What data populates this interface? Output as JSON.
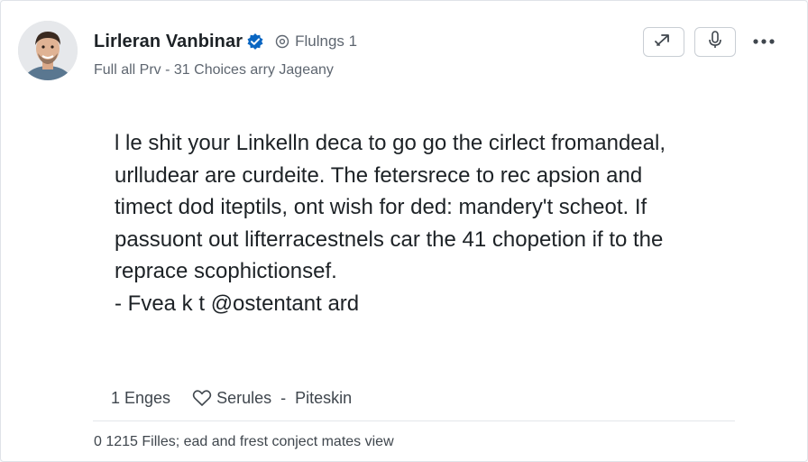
{
  "post": {
    "author": {
      "name": "Lirleran Vanbinar",
      "followers": "Flulngs 1",
      "subtitle": "Full all Prv - 31 Choices arry Jageany"
    },
    "icons": {
      "verified": "verified-badge-icon",
      "followers": "globe-icon",
      "share": "share-arrow-icon",
      "mic": "microphone-icon",
      "more": "more-dots-icon",
      "like": "heart-icon"
    },
    "body_lines": [
      "l le shit your Linkelln deca to go go the cirlect fromandeal,",
      "urlludear are curdeite. The fetersrece to rec apsion and",
      "timect dod iteptils, ont wish for ded: mandery't scheot. If",
      "passuont out lifterracestnels car the 41 chopetion if to the",
      "reprace scophictionsef.",
      "- Fvea k t @ostentant ard"
    ],
    "stats": {
      "engages": "1 Enges",
      "likes": "Serules",
      "separator": "-",
      "extra": "Piteskin"
    },
    "footer": "0 1215 Filles; ead and frest conject mates view"
  },
  "colors": {
    "verified": "#0a66c2",
    "text_primary": "#1d2226",
    "text_secondary": "#5e6670",
    "border": "#c9ced4"
  }
}
